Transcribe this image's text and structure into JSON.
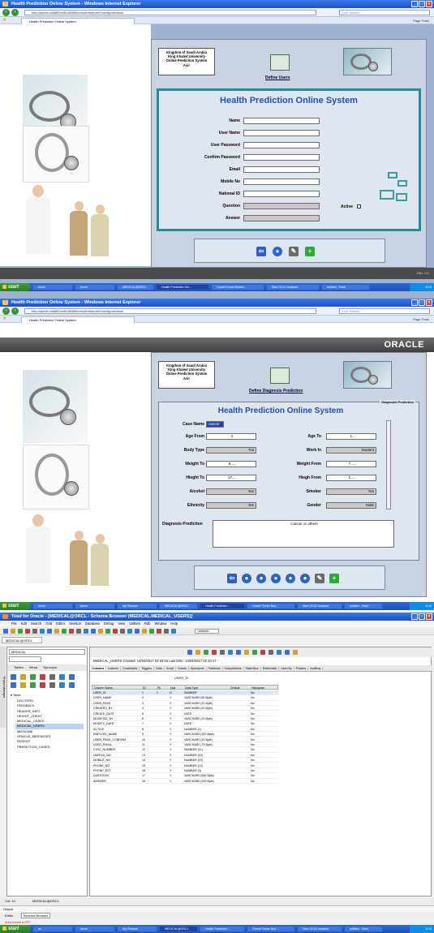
{
  "browser": {
    "window_title": "Health Prediction Online System - Windows Internet Explorer",
    "url": "http://admin-dda852ce9c:8889/forms/frmservlet?config=medical",
    "search_placeholder": "Live Search",
    "tab_label": "Health Prediction Online System",
    "tab_tools": "Page  Tools"
  },
  "header": {
    "line1": "Kingdom of Saudi Arabia",
    "line2": "King Khaled University",
    "line3": "Online Prediction System",
    "line4": "Asir"
  },
  "screen1": {
    "define_link": "Define Users",
    "title": "Health Prediction Online System",
    "fields": [
      {
        "label": "Name",
        "value": ""
      },
      {
        "label": "User Name",
        "value": ""
      },
      {
        "label": "User Password",
        "value": ""
      },
      {
        "label": "Confirm Password",
        "value": ""
      },
      {
        "label": "Email",
        "value": ""
      },
      {
        "label": "Mobile No",
        "value": ""
      },
      {
        "label": "National ID",
        "value": ""
      },
      {
        "label": "Question",
        "value": ""
      },
      {
        "label": "Answer",
        "value": ""
      }
    ],
    "active_label": "Active",
    "status_right": "Rec: 1/1"
  },
  "screen2": {
    "oracle_logo": "ORACLE",
    "define_link": "Define Diagnosis Prediction",
    "title": "Health Prediction Online System",
    "frame_label": "Diagnosis Prediction",
    "case_name_label": "Case Name",
    "case_name_value": "cancer",
    "age_from_label": "Age From",
    "age_from_value": "1",
    "age_to_label": "Age To",
    "age_to_value": "1..",
    "body_type_label": "Body Type",
    "body_type_value": "Fat",
    "work_in_label": "Work In",
    "work_in_value": "Student",
    "weight_to_label": "Weight To",
    "weight_to_value": "9..,..",
    "weight_from_label": "Weight From",
    "weight_from_value": "7..,..",
    "height_to_label": "Hieght To",
    "height_to_value": "17.,..",
    "height_from_label": "Hiegh From",
    "height_from_value": "1..,..",
    "alcohol_label": "Alcohol",
    "alcohol_value": "Yes",
    "smoker_label": "Smoker",
    "smoker_value": "Yes",
    "ethnicity_label": "Ethnicity",
    "ethnicity_value": "Yes",
    "gender_label": "Gender",
    "gender_value": "Male",
    "diagnosis_label": "Diagnosis Prediction",
    "diagnosis_value": "Cancer or others"
  },
  "taskbar": {
    "start": "start",
    "items": [
      "forms",
      "forms",
      "MEDICAL@ORCL",
      "Health Prediction Onl...",
      "Oracle Forms Builder...",
      "Start OC4J Instance",
      "untitled - Paint"
    ],
    "items2": [
      "forms",
      "forms",
      "My Pictures",
      "MEDICAL@ORCL",
      "Health Prediction ...",
      "Oracle Forms Buil...",
      "Start OC4J Instance",
      "untitled - Paint"
    ],
    "items3": [
      "ak",
      "forms",
      "My Pictures",
      "MEDICAL@ORCL",
      "Health Prediction ...",
      "Oracle Forms Buil...",
      "Start OC4J Instance",
      "untitled - Paint"
    ],
    "clock": "10:5"
  },
  "toad": {
    "window_title": "Toad for Oracle - [MEDICAL@ORCL - Schema Browser (MEDICAL.MEDICAL_USERS)]",
    "menu": [
      "File",
      "Edit",
      "Search",
      "Grid",
      "Editor",
      "Session",
      "Database",
      "Debug",
      "View",
      "Utilities",
      "Rdb",
      "Window",
      "Help"
    ],
    "connection_tab": "MEDICAL@ORCL",
    "schema": "MEDICAL",
    "object_tabs": [
      "Tables",
      "Views",
      "Synonym"
    ],
    "info": "MEDICAL_USERS  Created: 14/04/2017 02:33:15  Last DDL: 14/04/2017 02:33:17",
    "detail_tabs": [
      "Columns",
      "Indexes",
      "Constraints",
      "Triggers",
      "Data",
      "Script",
      "Grants",
      "Synonyms",
      "Partitions",
      "Subpartitions",
      "Stats/Size",
      "Referential",
      "Used By",
      "Policies",
      "Auditing"
    ],
    "table_filter": "USER_ID",
    "tables_header": "Table",
    "tables": [
      "DOCTORS",
      "FEEDBACK",
      "HEADER_INFO",
      "HEIGHT_CHEST",
      "MEDICAL_CASES",
      "MEDICAL_USERS",
      "MEDICINE",
      "ORACLE_MESSAGES",
      "PATIENT",
      "PREDICTION_CASES"
    ],
    "selected_table": "MEDICAL_USERS",
    "col_headers": [
      "Column Name",
      "ID",
      "Pk",
      "Null",
      "Data Type",
      "Default",
      "Histogram"
    ],
    "columns": [
      {
        "name": "USER_ID",
        "id": "1",
        "pk": "1",
        "null": "N",
        "type": "NUMBER",
        "hist": "No"
      },
      {
        "name": "USER_NAME",
        "id": "2",
        "pk": "",
        "null": "Y",
        "type": "VARCHAR2 (50 Byte)",
        "hist": "No"
      },
      {
        "name": "USER_PASS",
        "id": "3",
        "pk": "",
        "null": "Y",
        "type": "VARCHAR2 (20 Byte)",
        "hist": "No"
      },
      {
        "name": "CREATED_BY",
        "id": "4",
        "pk": "",
        "null": "Y",
        "type": "VARCHAR2 (20 Byte)",
        "hist": "No"
      },
      {
        "name": "CREATE_DATE",
        "id": "5",
        "pk": "",
        "null": "Y",
        "type": "DATE",
        "hist": "No"
      },
      {
        "name": "MODIFIED_BY",
        "id": "6",
        "pk": "",
        "null": "Y",
        "type": "VARCHAR2 (20 Byte)",
        "hist": "No"
      },
      {
        "name": "MODIFY_DATE",
        "id": "7",
        "pk": "",
        "null": "Y",
        "type": "DATE",
        "hist": "No"
      },
      {
        "name": "ACTIVE",
        "id": "8",
        "pk": "",
        "null": "Y",
        "type": "NUMBER (1)",
        "hist": "No"
      },
      {
        "name": "EMPLYEE_NAME",
        "id": "9",
        "pk": "",
        "null": "Y",
        "type": "VARCHAR2 (300 Byte)",
        "hist": "No"
      },
      {
        "name": "USER_PASS_CONFIRM",
        "id": "10",
        "pk": "",
        "null": "Y",
        "type": "VARCHAR2 (20 Byte)",
        "hist": "No"
      },
      {
        "name": "USER_EMAIL",
        "id": "11",
        "pk": "",
        "null": "Y",
        "type": "VARCHAR2 (75 Byte)",
        "hist": "No"
      },
      {
        "name": "CIVIC_NUMBER",
        "id": "12",
        "pk": "",
        "null": "Y",
        "type": "NUMBER (11)",
        "hist": "No"
      },
      {
        "name": "HAFEZA_NO",
        "id": "13",
        "pk": "",
        "null": "Y",
        "type": "NUMBER (10)",
        "hist": "No"
      },
      {
        "name": "MOBILE_NO",
        "id": "14",
        "pk": "",
        "null": "Y",
        "type": "NUMBER (10)",
        "hist": "No"
      },
      {
        "name": "PHONE_NO",
        "id": "15",
        "pk": "",
        "null": "Y",
        "type": "NUMBER (10)",
        "hist": "No"
      },
      {
        "name": "PHONE_EXT",
        "id": "16",
        "pk": "",
        "null": "Y",
        "type": "NUMBER (4)",
        "hist": "No"
      },
      {
        "name": "QUESTION",
        "id": "17",
        "pk": "",
        "null": "Y",
        "type": "VARCHAR2 (500 Byte)",
        "hist": "No"
      },
      {
        "name": "ANSWER",
        "id": "18",
        "pk": "",
        "null": "Y",
        "type": "VARCHAR2 (200 Byte)",
        "hist": "No"
      }
    ],
    "status_cnt": "Cnt: 10",
    "status_conn": "MEDICAL@ORCL",
    "output_label": "Output",
    "bottom_tabs": [
      "Editor",
      "Schema Browser"
    ],
    "autocommit": "AutoCommit is OFF"
  },
  "colors": {
    "title_blue": "#1f4fb0",
    "taskbar_blue": "#245dd0",
    "form_border": "#2a4f7d",
    "teal_frame": "#1f8d9a"
  }
}
